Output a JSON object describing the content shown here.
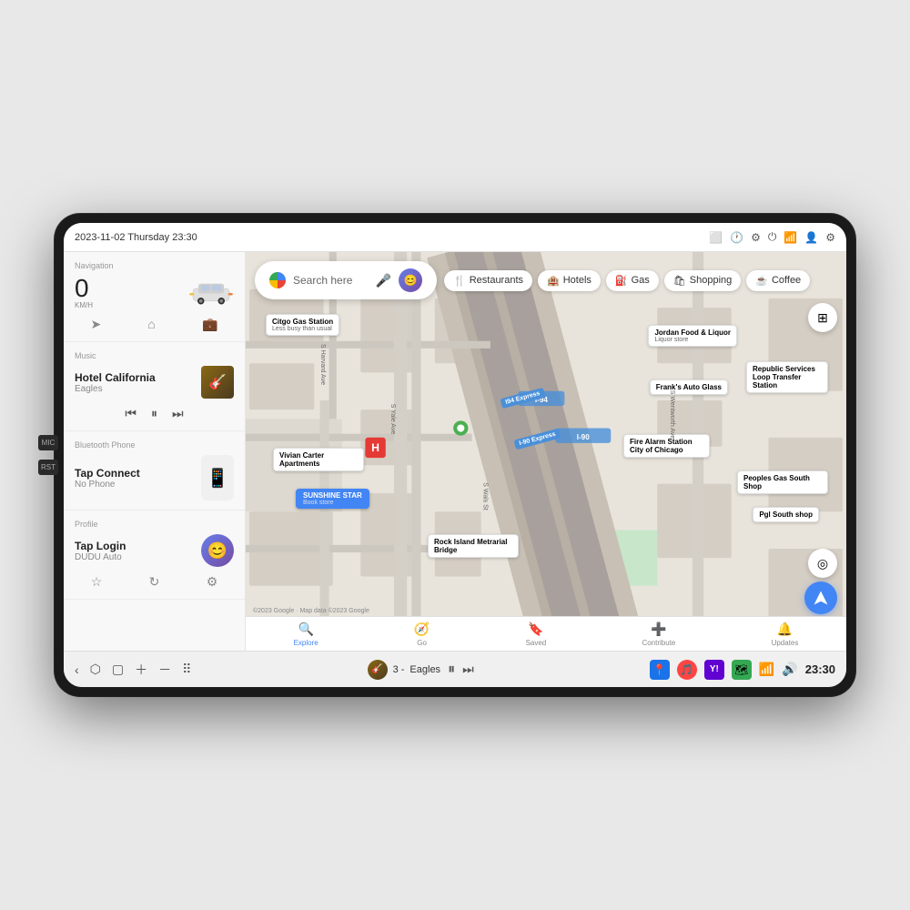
{
  "device": {
    "status_bar": {
      "datetime": "2023-11-02 Thursday 23:30",
      "icons": [
        "screen-icon",
        "clock-icon",
        "settings-wheel-icon",
        "power-icon",
        "wifi-icon",
        "user-icon",
        "gear-icon"
      ]
    },
    "side_buttons": [
      {
        "label": "MIC"
      },
      {
        "label": "RST"
      }
    ]
  },
  "sidebar": {
    "navigation": {
      "label": "Navigation",
      "speed": "0",
      "speed_unit": "KM/H",
      "controls": [
        "navigate-icon",
        "home-icon",
        "briefcase-icon"
      ]
    },
    "music": {
      "label": "Music",
      "title": "Hotel California",
      "artist": "Eagles",
      "controls": [
        "prev-icon",
        "pause-icon",
        "next-icon"
      ]
    },
    "bluetooth": {
      "label": "Bluetooth Phone",
      "title": "Tap Connect",
      "subtitle": "No Phone"
    },
    "profile": {
      "label": "Profile",
      "name": "Tap Login",
      "subtitle": "DUDU Auto",
      "controls": [
        "star-icon",
        "refresh-icon",
        "settings-icon"
      ]
    }
  },
  "map": {
    "search_placeholder": "Search here",
    "filter_chips": [
      {
        "label": "Restaurants",
        "icon": "🍴"
      },
      {
        "label": "Hotels",
        "icon": "🏨"
      },
      {
        "label": "Gas",
        "icon": "⛽"
      },
      {
        "label": "Shopping",
        "icon": "🛍"
      },
      {
        "label": "Coffee",
        "icon": "☕"
      }
    ],
    "bottom_nav": [
      {
        "label": "Explore",
        "icon": "🔍",
        "active": true
      },
      {
        "label": "Go",
        "icon": "🧭",
        "active": false
      },
      {
        "label": "Saved",
        "icon": "🔖",
        "active": false
      },
      {
        "label": "Contribute",
        "icon": "➕",
        "active": false
      },
      {
        "label": "Updates",
        "icon": "🔔",
        "active": false
      }
    ],
    "copyright": "©2023 Google · Map data ©2023 Google",
    "places": [
      {
        "name": "Citgo Gas Station",
        "sub": "Less busy than usual"
      },
      {
        "name": "Jordan Food & Liquor",
        "sub": "Liquor store"
      },
      {
        "name": "Frank's Auto Glass"
      },
      {
        "name": "Republic Services Loop Transfer Station"
      },
      {
        "name": "Fire Alarm Station City of Chicago"
      },
      {
        "name": "Vivian Carter Apartments"
      },
      {
        "name": "SUNSHINE STAR",
        "sub": "Book store"
      },
      {
        "name": "Peoples Gas South Shop"
      },
      {
        "name": "Pgl South shop"
      },
      {
        "name": "Rock Island Metrarial Bridge"
      }
    ]
  },
  "taskbar": {
    "left_icons": [
      "back-icon",
      "home-icon",
      "square-icon",
      "plus-icon",
      "minus-icon",
      "grid-icon"
    ],
    "track_name": "Eagles",
    "track_number": "3",
    "right_apps": [
      "location-icon",
      "music-icon",
      "yahoo-icon",
      "map-icon"
    ],
    "wifi_icon": "wifi-icon",
    "volume_icon": "volume-icon",
    "time": "23:30"
  }
}
